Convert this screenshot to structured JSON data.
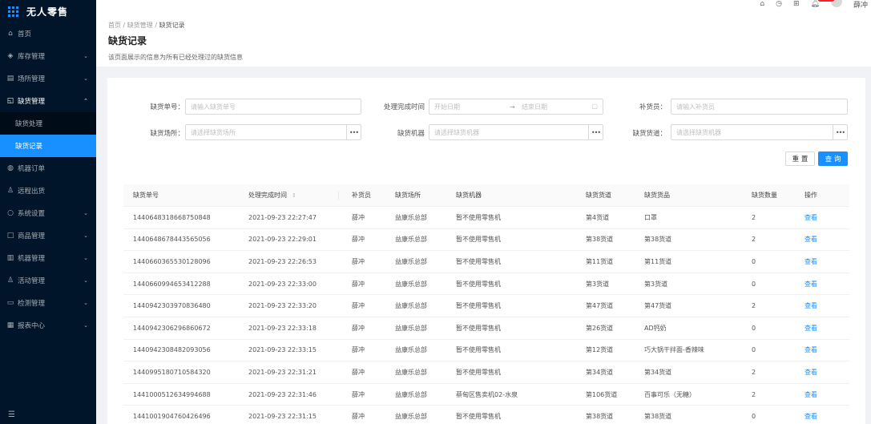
{
  "app": {
    "title": "无人零售"
  },
  "sidebar": {
    "items": [
      {
        "icon": "home-icon",
        "glyph": "⌂",
        "label": "首页",
        "arrow": ""
      },
      {
        "icon": "inventory-icon",
        "glyph": "◈",
        "label": "库存管理",
        "arrow": "⌄"
      },
      {
        "icon": "venue-icon",
        "glyph": "▤",
        "label": "场所管理",
        "arrow": "⌄"
      },
      {
        "icon": "shortage-icon",
        "glyph": "◱",
        "label": "缺货管理",
        "arrow": "⌃"
      }
    ],
    "submenu": [
      {
        "label": "缺货处理"
      },
      {
        "label": "缺货记录"
      }
    ],
    "items2": [
      {
        "icon": "machine-order-icon",
        "glyph": "◍",
        "label": "机器订单",
        "arrow": ""
      },
      {
        "icon": "remote-icon",
        "glyph": "♙",
        "label": "远程出货",
        "arrow": ""
      },
      {
        "icon": "settings-icon",
        "glyph": "○",
        "label": "系统设置",
        "arrow": "⌄"
      },
      {
        "icon": "product-icon",
        "glyph": "□",
        "label": "商品管理",
        "arrow": "⌄"
      },
      {
        "icon": "machine-icon",
        "glyph": "▥",
        "label": "机器管理",
        "arrow": "⌄"
      },
      {
        "icon": "activity-icon",
        "glyph": "♙",
        "label": "活动管理",
        "arrow": "⌄"
      },
      {
        "icon": "monitor-icon",
        "glyph": "▭",
        "label": "检测管理",
        "arrow": "⌄"
      },
      {
        "icon": "report-icon",
        "glyph": "▦",
        "label": "报表中心",
        "arrow": "⌄"
      }
    ]
  },
  "header": {
    "user_name": "薛冲",
    "icons": [
      "home-icon",
      "clock-icon",
      "grid-icon",
      "bell-icon"
    ]
  },
  "breadcrumb": {
    "home": "首页",
    "sep": "/",
    "parent": "缺货管理",
    "current": "缺货记录"
  },
  "page": {
    "title": "缺货记录",
    "description": "该页面展示的信息为所有已经处理过的缺货信息"
  },
  "filters": {
    "order_no_label": "缺货单号：",
    "order_no_placeholder": "请输入缺货单号",
    "finish_time_label": "处理完成时间",
    "start_placeholder": "开始日期",
    "range_sep": "→",
    "end_placeholder": "结束日期",
    "replenisher_label": "补货员：",
    "replenisher_placeholder": "请输入补货员",
    "venue_label": "缺货场所：",
    "venue_placeholder": "请选择缺货场所",
    "machine_label": "缺货机器",
    "machine_placeholder": "请选择缺货机器",
    "lane_label": "缺货货道：",
    "lane_placeholder": "请选择缺货机器",
    "dots": "•••",
    "reset_label": "重 置",
    "query_label": "查 询"
  },
  "table": {
    "headers": [
      "缺货单号",
      "处理完成时间",
      "补货员",
      "缺货场所",
      "缺货机器",
      "缺货货道",
      "缺货货品",
      "缺货数量",
      "操作"
    ],
    "rows": [
      [
        "1440648318668750848",
        "2021-09-23 22:27:47",
        "薛冲",
        "益康乐总部",
        "暂不使用零售机",
        "第4货道",
        "口罩",
        "2",
        "查看"
      ],
      [
        "1440648678443565056",
        "2021-09-23 22:29:01",
        "薛冲",
        "益康乐总部",
        "暂不使用零售机",
        "第38货道",
        "第38货道",
        "2",
        "查看"
      ],
      [
        "1440660365530128096",
        "2021-09-23 22:26:53",
        "薛冲",
        "益康乐总部",
        "暂不使用零售机",
        "第11货道",
        "第11货道",
        "0",
        "查看"
      ],
      [
        "1440660994653412288",
        "2021-09-23 22:33:00",
        "薛冲",
        "益康乐总部",
        "暂不使用零售机",
        "第3货道",
        "第3货道",
        "0",
        "查看"
      ],
      [
        "1440942303970836480",
        "2021-09-23 22:33:20",
        "薛冲",
        "益康乐总部",
        "暂不使用零售机",
        "第47货道",
        "第47货道",
        "2",
        "查看"
      ],
      [
        "1440942306296860672",
        "2021-09-23 22:33:18",
        "薛冲",
        "益康乐总部",
        "暂不使用零售机",
        "第26货道",
        "AD钙奶",
        "0",
        "查看"
      ],
      [
        "1440942308482093056",
        "2021-09-23 22:33:15",
        "薛冲",
        "益康乐总部",
        "暂不使用零售机",
        "第12货道",
        "巧大锅干拌面-香辣味",
        "0",
        "查看"
      ],
      [
        "1440995180710584320",
        "2021-09-23 22:31:21",
        "薛冲",
        "益康乐总部",
        "暂不使用零售机",
        "第34货道",
        "第34货道",
        "2",
        "查看"
      ],
      [
        "1441000512634994688",
        "2021-09-23 22:31:46",
        "薛冲",
        "益康乐总部",
        "蔡甸区售卖机02-水泉",
        "第106货道",
        "百事可乐（无糖）",
        "2",
        "查看"
      ],
      [
        "1441001904760426496",
        "2021-09-23 22:31:15",
        "薛冲",
        "益康乐总部",
        "暂不使用零售机",
        "第38货道",
        "第38货道",
        "0",
        "查看"
      ]
    ]
  }
}
